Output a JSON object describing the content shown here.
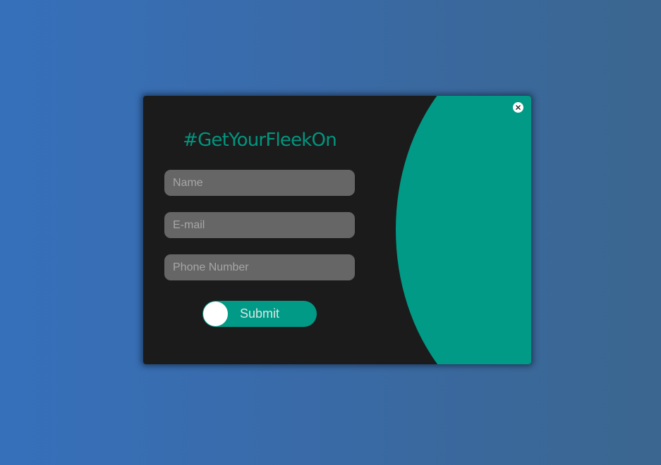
{
  "modal": {
    "title": "#GetYourFleekOn",
    "close_icon": "close-icon",
    "fields": {
      "name": {
        "placeholder": "Name",
        "value": ""
      },
      "email": {
        "placeholder": "E-mail",
        "value": ""
      },
      "phone": {
        "placeholder": "Phone Number",
        "value": ""
      }
    },
    "submit_label": "Submit"
  },
  "colors": {
    "accent": "#009a86",
    "panel_bg": "#1b1b1b",
    "field_bg": "#666666",
    "page_gradient_start": "#3670bb",
    "page_gradient_end": "#3a668f"
  }
}
